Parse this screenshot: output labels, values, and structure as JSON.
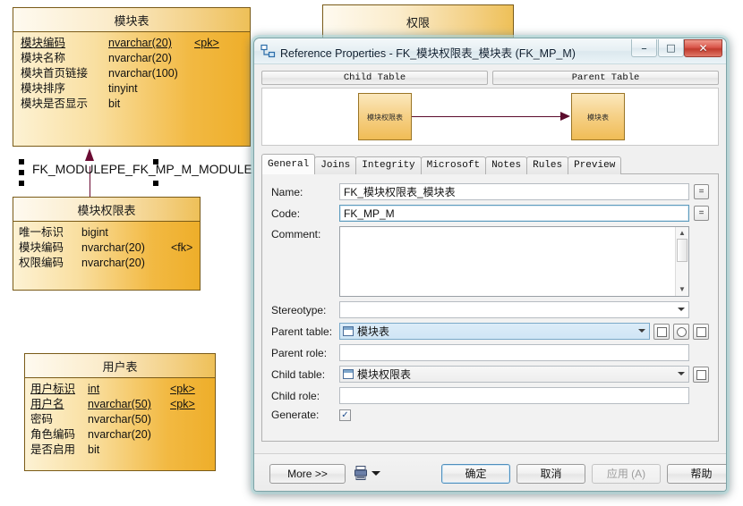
{
  "diagram": {
    "entities": [
      {
        "id": "module",
        "title": "模块表",
        "rows": [
          {
            "name": "模块编码",
            "type": "nvarchar(20)",
            "key": "<pk>",
            "underline": true
          },
          {
            "name": "模块名称",
            "type": "nvarchar(20)",
            "key": "",
            "underline": false
          },
          {
            "name": "模块首页链接",
            "type": "nvarchar(100)",
            "key": "",
            "underline": false
          },
          {
            "name": "模块排序",
            "type": "tinyint",
            "key": "",
            "underline": false
          },
          {
            "name": "模块是否显示",
            "type": "bit",
            "key": "",
            "underline": false
          }
        ]
      },
      {
        "id": "perm",
        "title": "权限",
        "rows": []
      },
      {
        "id": "modperm",
        "title": "模块权限表",
        "rows": [
          {
            "name": "唯一标识",
            "type": "bigint",
            "key": "",
            "underline": false
          },
          {
            "name": "模块编码",
            "type": "nvarchar(20)",
            "key": "<fk>",
            "underline": false
          },
          {
            "name": "权限编码",
            "type": "nvarchar(20)",
            "key": "",
            "underline": false
          }
        ]
      },
      {
        "id": "user",
        "title": "用户表",
        "rows": [
          {
            "name": "用户标识",
            "type": "int",
            "key": "<pk>",
            "underline": true
          },
          {
            "name": "用户名",
            "type": "nvarchar(50)",
            "key": "<pk>",
            "underline": true
          },
          {
            "name": "密码",
            "type": "nvarchar(50)",
            "key": "",
            "underline": false
          },
          {
            "name": "角色编码",
            "type": "nvarchar(20)",
            "key": "",
            "underline": false
          },
          {
            "name": "是否启用",
            "type": "bit",
            "key": "",
            "underline": false
          }
        ]
      }
    ],
    "link_label": "FK_MODULEPE_FK_MP_M_MODULE",
    "colors": {
      "entity_border": "#7a5b18",
      "link": "#6b0b33",
      "fill_start": "#fdf2d4",
      "fill_end": "#eeae2a"
    }
  },
  "dialog": {
    "title": "Reference Properties - FK_模块权限表_模块表 (FK_MP_M)",
    "icon": "reference-icon",
    "window_buttons": {
      "minimize": "–",
      "maximize": "□",
      "close": "✕"
    },
    "table_headers": {
      "child": "Child Table",
      "parent": "Parent Table"
    },
    "minidiagram": {
      "child_label": "模块权限表",
      "parent_label": "模块表"
    },
    "tabs": [
      {
        "label": "General",
        "active": true
      },
      {
        "label": "Joins",
        "active": false
      },
      {
        "label": "Integrity",
        "active": false
      },
      {
        "label": "Microsoft",
        "active": false
      },
      {
        "label": "Notes",
        "active": false
      },
      {
        "label": "Rules",
        "active": false
      },
      {
        "label": "Preview",
        "active": false
      }
    ],
    "fields": {
      "name_label": "Name:",
      "name_value": "FK_模块权限表_模块表",
      "code_label": "Code:",
      "code_value": "FK_MP_M",
      "comment_label": "Comment:",
      "comment_value": "",
      "stereotype_label": "Stereotype:",
      "stereotype_value": "",
      "parent_table_label": "Parent table:",
      "parent_table_value": "模块表",
      "parent_role_label": "Parent role:",
      "parent_role_value": "",
      "child_table_label": "Child table:",
      "child_table_value": "模块权限表",
      "child_role_label": "Child role:",
      "child_role_value": "",
      "generate_label": "Generate:",
      "generate_checked": "✓",
      "equals_button": "="
    },
    "footer": {
      "more": "More >>",
      "ok": "确定",
      "cancel": "取消",
      "apply": "应用 (A)",
      "help": "帮助"
    }
  }
}
